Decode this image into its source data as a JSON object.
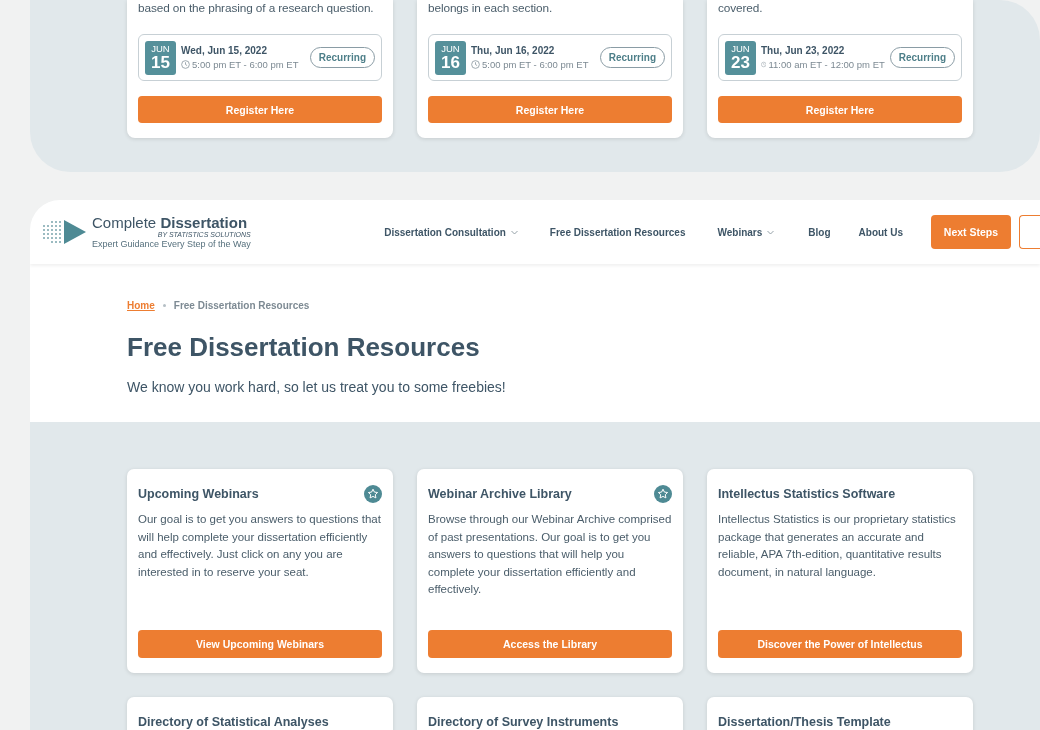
{
  "previous_section": {
    "events": [
      {
        "description_tail": "based on the phrasing of a research question.",
        "month": "JUN",
        "day": "15",
        "date": "Wed, Jun 15, 2022",
        "time": "5:00 pm ET - 6:00 pm ET",
        "tag": "Recurring",
        "button": "Register Here"
      },
      {
        "description_tail": "belongs in each section.",
        "month": "JUN",
        "day": "16",
        "date": "Thu, Jun 16, 2022",
        "time": "5:00 pm ET - 6:00 pm ET",
        "tag": "Recurring",
        "button": "Register Here"
      },
      {
        "description_tail": "covered.",
        "month": "JUN",
        "day": "23",
        "date": "Thu, Jun 23, 2022",
        "time": "11:00 am ET - 12:00 pm ET",
        "tag": "Recurring",
        "button": "Register Here"
      }
    ]
  },
  "header": {
    "logo": {
      "name": "Complete **Dissertation**",
      "byline": "BY STATISTICS SOLUTIONS",
      "tagline": "Expert Guidance Every Step of the Way"
    },
    "nav": [
      {
        "label": "Dissertation Consultation",
        "dropdown": true
      },
      {
        "label": "Free Dissertation Resources",
        "dropdown": false
      },
      {
        "label": "Webinars",
        "dropdown": true
      },
      {
        "label": "Blog",
        "dropdown": false
      },
      {
        "label": "About Us",
        "dropdown": false
      }
    ],
    "cta": "Next Steps"
  },
  "breadcrumb": [
    {
      "label": "Home",
      "kind": "link"
    },
    {
      "label": "Free Dissertation Resources",
      "kind": "current"
    }
  ],
  "page_title": "Free Dissertation Resources",
  "intro": "We know you work hard, so let us treat you to some freebies!",
  "resources": [
    {
      "title": "Upcoming Webinars",
      "featured": true,
      "description": "Our goal is to get you answers to questions that will help complete your dissertation efficiently and effectively. Just click on any you are interested in to reserve your seat.",
      "button": "View Upcoming Webinars"
    },
    {
      "title": "Webinar Archive Library",
      "featured": true,
      "description": "Browse through our Webinar Archive comprised of past presentations. Our goal is to get you answers to questions that will help you complete your dissertation efficiently and effectively.",
      "button": "Access the Library"
    },
    {
      "title": "Intellectus Statistics Software",
      "featured": false,
      "description": "Intellectus Statistics is our proprietary statistics package that generates an accurate and reliable, APA 7th-edition, quantitative results document, in natural language.",
      "button": "Discover the Power of Intellectus"
    },
    {
      "title": "Directory of Statistical Analyses",
      "featured": false
    },
    {
      "title": "Directory of Survey Instruments",
      "featured": false
    },
    {
      "title": "Dissertation/Thesis Template",
      "featured": false
    }
  ]
}
